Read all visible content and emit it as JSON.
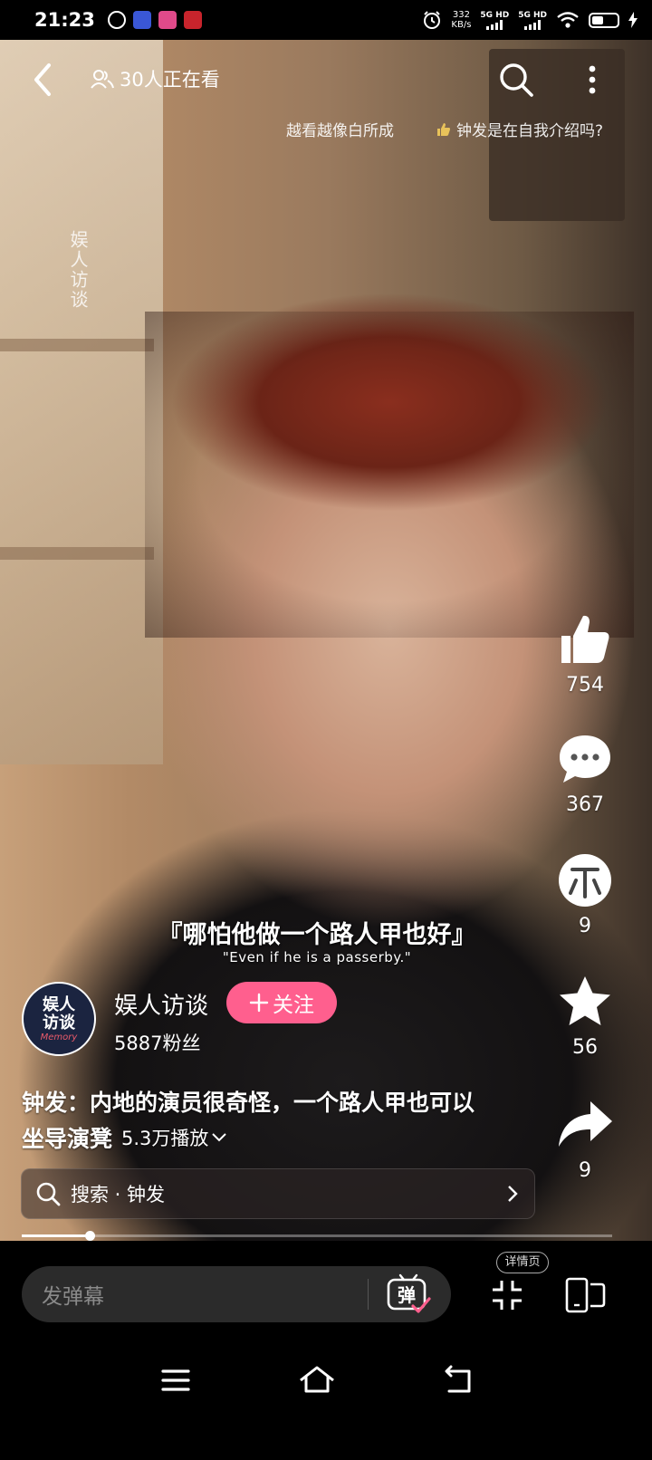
{
  "status_bar": {
    "time": "21:23",
    "net_speed_value": "332",
    "net_speed_unit": "KB/s",
    "signal1": "5G HD",
    "signal2": "5G HD"
  },
  "top_bar": {
    "viewers": "30人正在看"
  },
  "hints": {
    "hint1": "越看越像白所成",
    "hint2": "钟发是在自我介绍吗?"
  },
  "watermark": "娱人访谈",
  "rail": {
    "likes": "754",
    "comments": "367",
    "coins": "9",
    "favorites": "56",
    "shares": "9"
  },
  "subtitles": {
    "cn": "『哪怕他做一个路人甲也好』",
    "en": "\"Even if he is a passerby.\""
  },
  "author": {
    "avatar_line1": "娱人",
    "avatar_line2": "访谈",
    "avatar_line3": "Memory",
    "name": "娱人访谈",
    "follow_label": "关注",
    "fans": "5887粉丝"
  },
  "video": {
    "title_line1": "钟发：内地的演员很奇怪，一个路人甲也可以",
    "title_line2": "坐导演凳",
    "plays": "5.3万播放"
  },
  "search": {
    "text": "搜索 · 钟发"
  },
  "playback": {
    "progress_fraction": 0.115
  },
  "bottom_bar": {
    "danmaku_placeholder": "发弹幕",
    "danmaku_toggle": "弹",
    "detail_label": "详情页"
  },
  "colors": {
    "follow": "#ff5f8e",
    "accent": "#ff5f8e"
  }
}
